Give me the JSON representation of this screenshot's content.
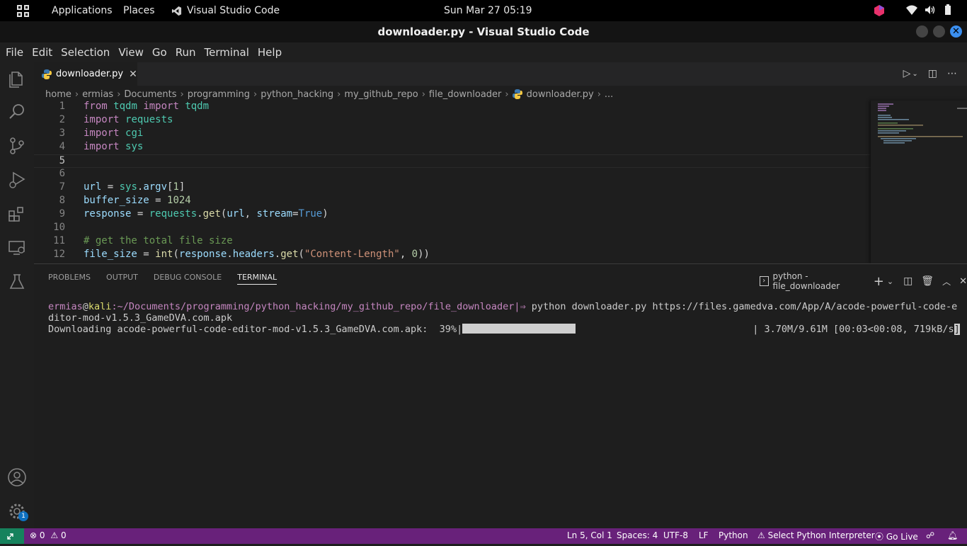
{
  "system_panel": {
    "applications": "Applications",
    "places": "Places",
    "active_app": "Visual Studio Code",
    "clock": "Sun Mar 27  05:19"
  },
  "window": {
    "title": "downloader.py - Visual Studio Code"
  },
  "menu": [
    "File",
    "Edit",
    "Selection",
    "View",
    "Go",
    "Run",
    "Terminal",
    "Help"
  ],
  "editor": {
    "tab_label": "downloader.py",
    "breadcrumb": [
      "home",
      "ermias",
      "Documents",
      "programming",
      "python_hacking",
      "my_github_repo",
      "file_downloader",
      "downloader.py",
      "..."
    ],
    "active_line": 5,
    "line_numbers": [
      "1",
      "2",
      "3",
      "4",
      "5",
      "6",
      "7",
      "8",
      "9",
      "10",
      "11",
      "12"
    ],
    "lines": [
      "from tqdm import tqdm",
      "import requests",
      "import cgi",
      "import sys",
      "",
      "",
      "url = sys.argv[1]",
      "buffer_size = 1024",
      "response = requests.get(url, stream=True)",
      "",
      "# get the total file size",
      "file_size = int(response.headers.get(\"Content-Length\", 0))"
    ]
  },
  "panel": {
    "tabs": [
      "PROBLEMS",
      "OUTPUT",
      "DEBUG CONSOLE",
      "TERMINAL"
    ],
    "active_tab": "TERMINAL",
    "terminal_name": "python - file_downloader"
  },
  "terminal": {
    "user": "ermias",
    "at": "@",
    "host": "kali",
    "path": ":~/Documents/programming/python_hacking/my_github_repo/file_downloader",
    "prompt_sep": "|⇒",
    "command": " python downloader.py https://files.gamedva.com/App/A/acode-powerful-code-e",
    "command_wrap": "ditor-mod-v1.5.3_GameDVA.com.apk",
    "progress_prefix": "Downloading acode-powerful-code-editor-mod-v1.5.3_GameDVA.com.apk:  39%|",
    "progress_fraction": 0.39,
    "progress_suffix": "| 3.70M/9.61M [00:03<00:08, 719kB/s",
    "cursor_char": "]"
  },
  "statusbar": {
    "errors": "0",
    "warnings": "0",
    "position": "Ln 5, Col 1",
    "spaces": "Spaces: 4",
    "encoding": "UTF-8",
    "eol": "LF",
    "language": "Python",
    "interpreter": "Select Python Interpreter",
    "golive": "Go Live",
    "badge_count": "1"
  },
  "colors": {
    "status_bar": "#68217a",
    "remote_indicator": "#16825d",
    "accent": "#0e70c0"
  }
}
